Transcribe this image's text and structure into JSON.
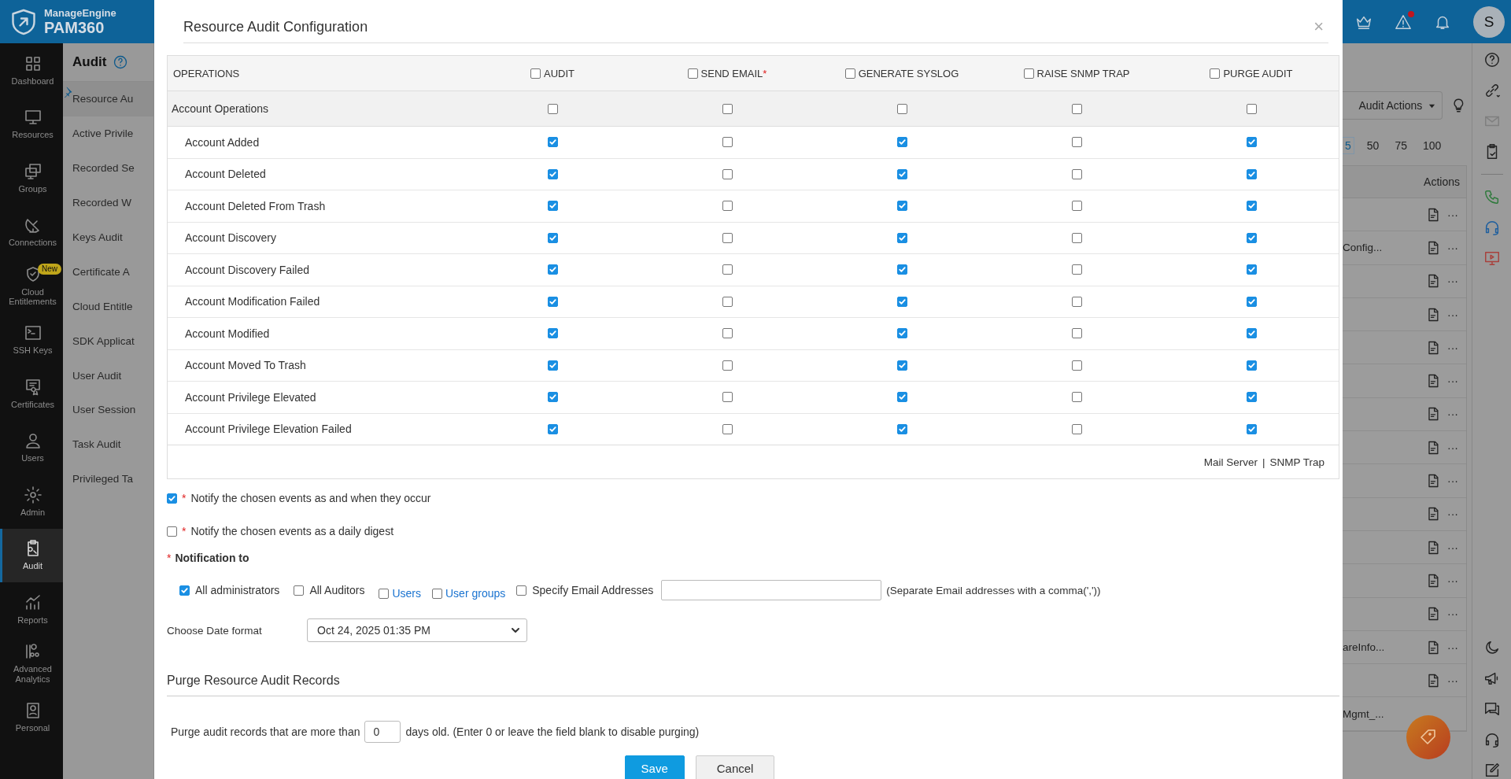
{
  "header": {
    "brand": "ManageEngine",
    "product": "PAM360",
    "has_alert": true,
    "avatar": "S"
  },
  "nav": [
    {
      "label": "Dashboard",
      "selected": false
    },
    {
      "label": "Resources",
      "selected": false
    },
    {
      "label": "Groups",
      "selected": false
    },
    {
      "label": "Connections",
      "selected": false
    },
    {
      "label": "Cloud Entitlements",
      "selected": false,
      "badge": "New"
    },
    {
      "label": "SSH Keys",
      "selected": false
    },
    {
      "label": "Certificates",
      "selected": false
    },
    {
      "label": "Users",
      "selected": false
    },
    {
      "label": "Admin",
      "selected": false
    },
    {
      "label": "Audit",
      "selected": true
    },
    {
      "label": "Reports",
      "selected": false
    },
    {
      "label": "Advanced Analytics",
      "selected": false
    },
    {
      "label": "Personal",
      "selected": false
    }
  ],
  "submenu": {
    "title": "Audit",
    "items": [
      {
        "label": "Resource Au",
        "selected": true
      },
      {
        "label": "Active Privile",
        "selected": false
      },
      {
        "label": "Recorded Se",
        "selected": false
      },
      {
        "label": "Recorded W",
        "selected": false
      },
      {
        "label": "Keys Audit",
        "selected": false
      },
      {
        "label": "Certificate A",
        "selected": false
      },
      {
        "label": "Cloud Entitle",
        "selected": false
      },
      {
        "label": "SDK Applicat",
        "selected": false
      },
      {
        "label": "User Audit",
        "selected": false
      },
      {
        "label": "User Session",
        "selected": false
      },
      {
        "label": "Task Audit",
        "selected": false
      },
      {
        "label": "Privileged Ta",
        "selected": false
      }
    ]
  },
  "background": {
    "actions_menu": "Audit Actions",
    "page_sizes": [
      {
        "label": "5",
        "selected": true
      },
      {
        "label": "50",
        "selected": false
      },
      {
        "label": "75",
        "selected": false
      },
      {
        "label": "100",
        "selected": false
      }
    ],
    "table": {
      "columns": [
        "Actions"
      ],
      "rows": [
        {
          "more": "···"
        },
        {
          "name": "Config...",
          "more": "···"
        },
        {
          "more": "···"
        },
        {
          "more": "···"
        },
        {
          "more": "···"
        },
        {
          "more": "···"
        },
        {
          "more": "···"
        },
        {
          "more": "···"
        },
        {
          "more": "···"
        },
        {
          "more": "···"
        },
        {
          "more": "···"
        },
        {
          "more": "···"
        },
        {
          "more": "···"
        },
        {
          "name": "areInfo...",
          "more": "···"
        },
        {
          "more": "···"
        },
        {
          "name": "Mgmt_..."
        }
      ]
    }
  },
  "modal": {
    "title": "Resource Audit Configuration",
    "close": "×",
    "first_column": "OPERATIONS",
    "columns": [
      {
        "label": "AUDIT",
        "checked": false
      },
      {
        "label": "SEND EMAIL",
        "required_mark": "*",
        "checked": false
      },
      {
        "label": "GENERATE SYSLOG",
        "checked": false
      },
      {
        "label": "RAISE SNMP TRAP",
        "checked": false
      },
      {
        "label": "PURGE AUDIT",
        "checked": false
      }
    ],
    "group": {
      "label": "Account Operations",
      "checks": [
        false,
        false,
        false,
        false,
        false
      ]
    },
    "rows": [
      {
        "label": "Account Added",
        "checks": [
          true,
          false,
          true,
          false,
          true
        ]
      },
      {
        "label": "Account Deleted",
        "checks": [
          true,
          false,
          true,
          false,
          true
        ]
      },
      {
        "label": "Account Deleted From Trash",
        "checks": [
          true,
          false,
          true,
          false,
          true
        ]
      },
      {
        "label": "Account Discovery",
        "checks": [
          true,
          false,
          true,
          false,
          true
        ]
      },
      {
        "label": "Account Discovery Failed",
        "checks": [
          true,
          false,
          true,
          false,
          true
        ]
      },
      {
        "label": "Account Modification Failed",
        "checks": [
          true,
          false,
          true,
          false,
          true
        ]
      },
      {
        "label": "Account Modified",
        "checks": [
          true,
          false,
          true,
          false,
          true
        ]
      },
      {
        "label": "Account Moved To Trash",
        "checks": [
          true,
          false,
          true,
          false,
          true
        ]
      },
      {
        "label": "Account Privilege Elevated",
        "checks": [
          true,
          false,
          true,
          false,
          true
        ]
      },
      {
        "label": "Account Privilege Elevation Failed",
        "checks": [
          true,
          false,
          true,
          false,
          true
        ]
      }
    ],
    "footer_links": [
      "Mail Server",
      "SNMP Trap"
    ],
    "footer_separator": "|",
    "notify_options": [
      {
        "mark": "*",
        "label": "Notify the chosen events as and when they occur",
        "checked": true
      },
      {
        "mark": "*",
        "label": "Notify the chosen events as a daily digest",
        "checked": false
      }
    ],
    "notification_to": {
      "mark": "*",
      "label": "Notification to",
      "recipients": [
        {
          "label": "All administrators",
          "checked": true,
          "kind": "plain"
        },
        {
          "label": "All Auditors",
          "checked": false,
          "kind": "plain"
        },
        {
          "label": "Users",
          "checked": false,
          "kind": "link"
        },
        {
          "label": "User groups",
          "checked": false,
          "kind": "link"
        },
        {
          "label": "Specify Email Addresses",
          "checked": false,
          "kind": "plain"
        }
      ],
      "email_hint": "(Separate Email addresses with a comma(','))"
    },
    "date_format": {
      "label": "Choose Date format",
      "value": "Oct 24, 2025 01:35 PM"
    },
    "purge": {
      "title": "Purge Resource Audit Records",
      "before": "Purge audit records that are more than",
      "days": "0",
      "after": "days old. (Enter 0 or leave the field blank to disable purging)"
    },
    "buttons": [
      {
        "label": "Save",
        "kind": "primary"
      },
      {
        "label": "Cancel",
        "kind": "secondary"
      }
    ]
  }
}
